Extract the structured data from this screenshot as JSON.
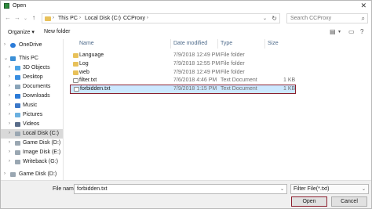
{
  "window": {
    "title": "Open",
    "close_glyph": "✕"
  },
  "address": {
    "crumbs": [
      "This PC",
      "Local Disk (C:)",
      "CCProxy"
    ],
    "search_placeholder": "Search CCProxy"
  },
  "toolbar": {
    "organize": "Organize ▾",
    "new_folder": "New folder"
  },
  "nav": {
    "items": [
      {
        "label": "OneDrive",
        "icon": "cloud-icon",
        "color": "#2b7bd8"
      },
      {
        "label": "This PC",
        "icon": "computer-icon",
        "color": "#3b8fd6"
      },
      {
        "label": "3D Objects",
        "icon": "cube-icon",
        "color": "#4aa3e6"
      },
      {
        "label": "Desktop",
        "icon": "desktop-icon",
        "color": "#3a8ee0"
      },
      {
        "label": "Documents",
        "icon": "documents-icon",
        "color": "#8aa4b9"
      },
      {
        "label": "Downloads",
        "icon": "download-icon",
        "color": "#2b7bd8"
      },
      {
        "label": "Music",
        "icon": "music-icon",
        "color": "#3b78c8"
      },
      {
        "label": "Pictures",
        "icon": "pictures-icon",
        "color": "#6ab0e0"
      },
      {
        "label": "Videos",
        "icon": "videos-icon",
        "color": "#5a6d8a"
      },
      {
        "label": "Local Disk (C:)",
        "icon": "drive-icon",
        "color": "#9aa7b2"
      },
      {
        "label": "Game Disk (D:)",
        "icon": "drive-icon",
        "color": "#9aa7b2"
      },
      {
        "label": "Image Disk (E:)",
        "icon": "drive-icon",
        "color": "#9aa7b2"
      },
      {
        "label": "Writeback (G:)",
        "icon": "drive-icon",
        "color": "#9aa7b2"
      },
      {
        "label": "Game Disk (D:)",
        "icon": "drive-icon",
        "color": "#9aa7b2"
      }
    ]
  },
  "columns": {
    "name": "Name",
    "date": "Date modified",
    "type": "Type",
    "size": "Size"
  },
  "files": [
    {
      "name": "Language",
      "date": "7/9/2018 12:49 PM",
      "type": "File folder",
      "size": "",
      "kind": "folder"
    },
    {
      "name": "Log",
      "date": "7/9/2018 12:55 PM",
      "type": "File folder",
      "size": "",
      "kind": "folder"
    },
    {
      "name": "web",
      "date": "7/9/2018 12:49 PM",
      "type": "File folder",
      "size": "",
      "kind": "folder"
    },
    {
      "name": "filter.txt",
      "date": "7/6/2018 4:46 PM",
      "type": "Text Document",
      "size": "1 KB",
      "kind": "file"
    },
    {
      "name": "forbidden.txt",
      "date": "7/9/2018 1:15 PM",
      "type": "Text Document",
      "size": "1 KB",
      "kind": "file"
    }
  ],
  "bottom": {
    "file_name_label": "File name:",
    "file_name_value": "forbidden.txt",
    "filter": "Filter File(*.txt)",
    "open": "Open",
    "cancel": "Cancel"
  }
}
